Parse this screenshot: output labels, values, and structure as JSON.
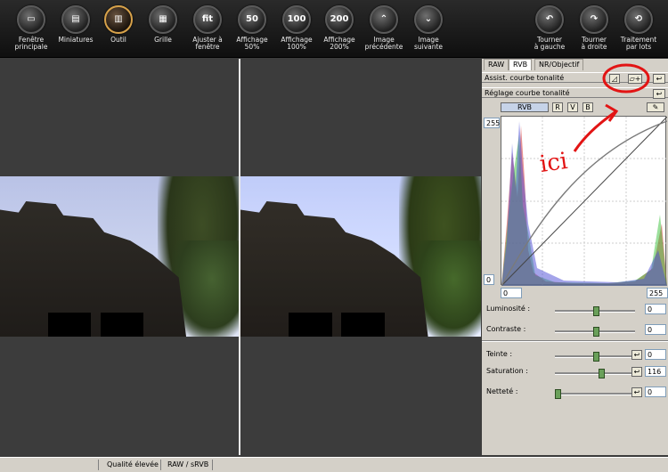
{
  "toolbar": [
    {
      "id": "fenetre",
      "label": "Fenêtre\nprincipale",
      "glyph": "▭"
    },
    {
      "id": "miniatures",
      "label": "Miniatures",
      "glyph": "▤"
    },
    {
      "id": "outil",
      "label": "Outil",
      "glyph": "▥",
      "selected": true
    },
    {
      "id": "grille",
      "label": "Grille",
      "glyph": "▦"
    },
    {
      "id": "ajuster",
      "label": "Ajuster à\nfenêtre",
      "glyph": "fit"
    },
    {
      "id": "aff50",
      "label": "Affichage\n50%",
      "glyph": "50"
    },
    {
      "id": "aff100",
      "label": "Affichage\n100%",
      "glyph": "100"
    },
    {
      "id": "aff200",
      "label": "Affichage\n200%",
      "glyph": "200"
    },
    {
      "id": "prec",
      "label": "Image\nprécédente",
      "glyph": "⌃"
    },
    {
      "id": "suiv",
      "label": "Image\nsuivante",
      "glyph": "⌄"
    },
    {
      "id": "tgauche",
      "label": "Tourner\nà gauche",
      "glyph": "↶"
    },
    {
      "id": "tdroite",
      "label": "Tourner\nà droite",
      "glyph": "↷"
    },
    {
      "id": "lots",
      "label": "Traitement\npar lots",
      "glyph": "⟲"
    }
  ],
  "panel": {
    "tabs": [
      "RAW",
      "RVB",
      "NR/Objectif"
    ],
    "assist_label": "Assist. courbe tonalité",
    "reglage_label": "Réglage courbe tonalité",
    "channel_buttons": [
      "RVB",
      "R",
      "V",
      "B"
    ],
    "graph_max": "255",
    "graph_min": "0",
    "input_min": "0",
    "input_max": "255",
    "annotation": "ici",
    "sliders": [
      {
        "label": "Luminosité :",
        "value": "0",
        "level": 0.5,
        "has_undo": false
      },
      {
        "label": "Contraste :",
        "value": "0",
        "level": 0.5,
        "has_undo": false
      },
      {
        "label": "Teinte :",
        "value": "0",
        "level": 0.5,
        "has_undo": true
      },
      {
        "label": "Saturation :",
        "value": "116",
        "level": 0.58,
        "has_undo": true
      },
      {
        "label": "Netteté :",
        "value": "0",
        "level": 0.0,
        "has_undo": true
      }
    ]
  },
  "status": {
    "quality": "Qualité élevée",
    "color": "RAW / sRVB"
  }
}
